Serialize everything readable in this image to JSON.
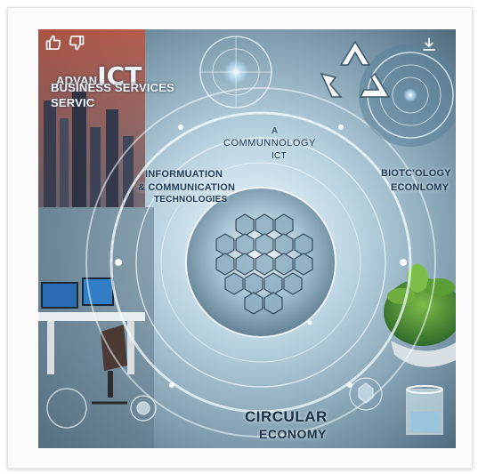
{
  "image_labels": {
    "title_prefix": "ADVAN",
    "title_main": "ICT",
    "subtitle_line1": "BUSINESS SERVICES",
    "subtitle_line2": "SERVIC",
    "center_small": "A",
    "center_line1": "COMMUNNOLOGY",
    "center_line2": "ICT",
    "left_line1": "INFORMUATION",
    "left_line2": "& COMMUNICATION",
    "left_line3": "TECHNOLOGIES",
    "right_line1": "BIOTC'OLOGY",
    "right_line2": "ECONLOMY",
    "bottom_line1": "CIRCULAR",
    "bottom_line2": "ECONOMY"
  },
  "toolbar": {
    "like_icon": "thumbs-up-icon",
    "dislike_icon": "thumbs-down-icon",
    "download_icon": "download-icon"
  },
  "colors": {
    "art_center": "#e8f4fb",
    "art_edge": "#4f7286",
    "accent_glow": "#bfe6ff"
  }
}
